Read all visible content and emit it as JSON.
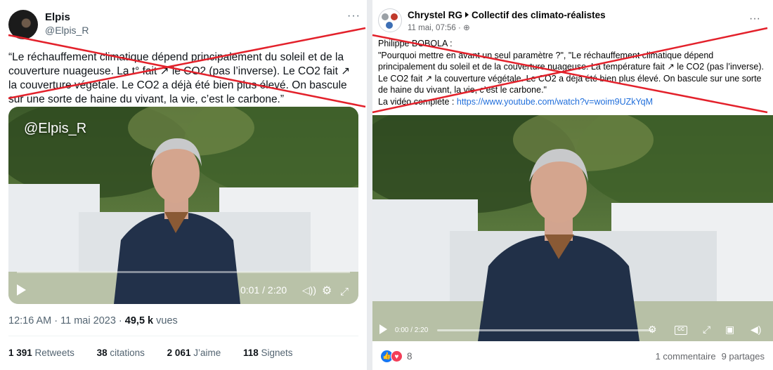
{
  "tweet": {
    "display_name": "Elpis",
    "handle": "@Elpis_R",
    "more": "···",
    "text": "“Le réchauffement climatique dépend principalement du soleil et de la couverture nuageuse. La t° fait ↗ le CO2 (pas l’inverse). Le CO2 fait ↗ la couverture végétale. Le CO2 a déjà été bien plus élevé. On bascule sur une sorte de haine du vivant, la vie, c’est le carbone.”",
    "video": {
      "watermark": "@Elpis_R",
      "time": "0:01 / 2:20",
      "progress": 0.01
    },
    "meta_time": "12:16 AM · 11 mai 2023 · ",
    "views_value": "49,5 k",
    "views_label": " vues",
    "stats": {
      "retweets_value": "1 391",
      "retweets_label": " Retweets",
      "quotes_value": "38",
      "quotes_label": " citations",
      "likes_value": "2 061",
      "likes_label": " J’aime",
      "bookmarks_value": "118",
      "bookmarks_label": " Signets"
    }
  },
  "facebook": {
    "author": "Chrystel RG",
    "group": "Collectif des climato-réalistes",
    "date": "11 mai, 07:56 · ",
    "more": "···",
    "text_intro": "Philippe BOBOLA :",
    "text_body": "\"Pourquoi mettre en avant un seul paramètre ?\", \"Le réchauffement climatique dépend principalement du soleil et de la couverture nuageuse. La température fait ↗ le CO2 (pas l’inverse). Le CO2 fait ↗ la couverture végétale. Le CO2 a déjà été bien plus élevé. On bascule sur une sorte de haine du vivant, la vie, c’est le carbone.\"",
    "video_label": "La vidéo complète  : ",
    "video_link": "https://www.youtube.com/watch?v=woim9UZkYqM",
    "video": {
      "time": "0:00 / 2:20",
      "progress": 0.0
    },
    "reactions_count": "8",
    "comments": "1 commentaire",
    "shares": "9 partages"
  },
  "colors": {
    "cross": "#e3212b",
    "link": "#216fdb",
    "like_blue": "#1877f2",
    "love_red": "#f33e58"
  },
  "icons": [
    "play-icon",
    "volume-icon",
    "settings-icon",
    "fullscreen-icon",
    "globe-icon",
    "captions-icon",
    "pip-icon",
    "more-icon"
  ]
}
